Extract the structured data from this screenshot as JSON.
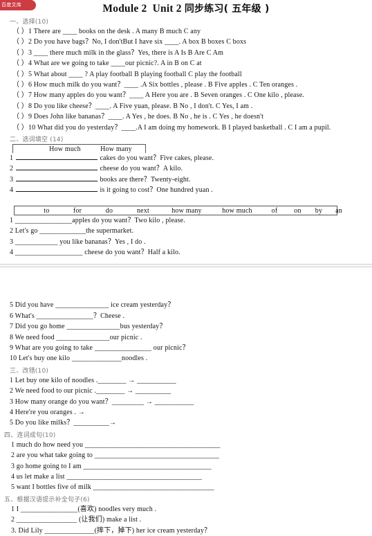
{
  "watermark": {
    "label": "百度文库"
  },
  "title": {
    "en_part1": "Module 2",
    "en_part2": "Unit 2",
    "cn_part": "同步练习( 五年级 )"
  },
  "sections": {
    "one": {
      "heading": "一、选择(10)",
      "items": [
        "（   ）1 There are ____ books on the desk . A many       B much        C any",
        "（   ）2 Do you have bags？No, I don'tBut I have six ____.   A box      B boxes      C boxs",
        "（   ）3 ____ there much milk in the glass？Yes, there is  A Is        B Are     C Am",
        "（   ）4 What are we going to take ____our picnic?.  A in        B on        C at",
        "（   ）5 What about ____ ?     A play football      B playing football       C play the football",
        "（   ）6 How much milk do you want？____ .A Six bottles , please . B Five apples .    C Ten oranges .",
        "（   ）7 How many apples do you want？____ A Here you are .  B Seven oranges .   C One kilo , please.",
        "（   ）8 Do you like cheese？____.    A Five yuan, please.   B No , I don't.       C Yes, I am .",
        "（   ）9 Does John like bananas？____. A Yes , he does.    B No , he is .   C Yes , he doesn't",
        "（   ）10 What did you do yesterday？____.A I am doing my homework. B I played basketball .   C I am a pupil."
      ]
    },
    "two": {
      "heading": "二、选词填空 (14)",
      "bank1": [
        "How much",
        "How many"
      ],
      "items_a": [
        {
          "num": "1",
          "text": "cakes do you want？Five cakes, please."
        },
        {
          "num": "2",
          "text": "cheese do you want？A kilo."
        },
        {
          "num": "3",
          "text": "books are there？Twenty-eight."
        },
        {
          "num": "4",
          "text": "is it going to cost？One hundred yuan ."
        }
      ],
      "bank2": [
        "to",
        "for",
        "do",
        "next",
        "how many",
        "how much",
        "of",
        "on",
        "by",
        "an"
      ],
      "items_b": [
        "1 ________________apples do you want？Two kilo , please.",
        "2 Let's go _____________the supermarket.",
        "3 ____________ you like bananas？Yes , I do .",
        "4 ___________________ cheese do you want？Half a kilo."
      ],
      "items_c": [
        "5 Did you have _______________ ice cream yesterday？",
        "6 What's ________________？Cheese .",
        "7 Did you go home _______________bus yesterday？",
        "8 We need food _______________our picnic .",
        "9 What are you going to take ________________ our picnic？",
        "10 Let's buy one kilo ______________noodles ."
      ]
    },
    "three": {
      "heading": "三、改错(10)",
      "items": [
        "1 Let buy one kilo of noodles .________ → ___________",
        "2 We need food to our picnic .________ → __________",
        "3 How many orange do you want？_________ → ___________",
        "4 Here're you oranges .              →",
        "5 Do you like milks？__________→"
      ]
    },
    "four": {
      "heading": "四、连词成句(10)",
      "items": [
        "1 much    do    how    need    you   ______________________________________",
        "2 are    you    what    take    going    to ___________________________________",
        "3 go    home    going     to     I    am ____________________________________",
        "4 us    let    make    a    list ______________________________________",
        "5 want    I    bottles    five    of    milk __________________________________"
      ]
    },
    "five": {
      "heading": "五、根据汉语提示补全句子(6)",
      "items": [
        "1 I ________________(喜欢) noodles very much .",
        "2  _________________ (让我们) make a list .",
        "3. Did Lily ______________(摔下，掉下) her ice cream yesterday？"
      ]
    }
  }
}
